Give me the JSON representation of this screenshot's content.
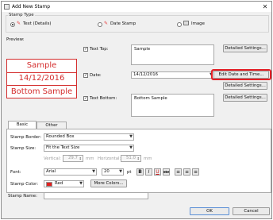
{
  "window": {
    "title": "Add New Stamp",
    "close_glyph": "✕"
  },
  "stamp_type": {
    "label": "Stamp Type",
    "options": [
      {
        "label": "Text (Details)",
        "selected": true
      },
      {
        "label": "Date Stamp",
        "selected": false
      },
      {
        "label": "Image",
        "selected": false
      }
    ]
  },
  "preview": {
    "label": "Preview:",
    "lines": [
      "Sample",
      "14/12/2016",
      "Bottom Sample"
    ],
    "color": "#d42d2d"
  },
  "text_top": {
    "label": "Text Top:",
    "checked": true,
    "value": "Sample",
    "button": "Detailed Settings..."
  },
  "date": {
    "label": "Date:",
    "checked": true,
    "value": "14/12/2016",
    "edit_button": "Edit Date and Time...",
    "button": "Detailed Settings..."
  },
  "text_bottom": {
    "label": "Text Bottom:",
    "checked": true,
    "value": "Bottom Sample",
    "button": "Detailed Settings..."
  },
  "tabs": [
    {
      "label": "Basic Settings",
      "active": true
    },
    {
      "label": "Other Settings",
      "active": false
    }
  ],
  "basic": {
    "border_label": "Stamp Border:",
    "border_value": "Rounded Box",
    "size_label": "Stamp Size:",
    "size_value": "Fit the Text Size",
    "vertical_label": "Vertical:",
    "vertical_value": "29.7",
    "horizontal_label": "Horizontal:",
    "horizontal_value": "51.0",
    "unit": "mm",
    "font_label": "Font:",
    "font_value": "Arial",
    "font_size": "20",
    "font_unit": "pt",
    "style_buttons": [
      "B",
      "I",
      "U",
      "abc"
    ],
    "align_buttons": [
      "≡",
      "≡",
      "≡"
    ],
    "color_label": "Stamp Color:",
    "color_value": "Red",
    "color_hex": "#e0201f",
    "more_colors": "More Colors..."
  },
  "stamp_name": {
    "label": "Stamp Name:",
    "value": ""
  },
  "footer": {
    "ok": "OK",
    "cancel": "Cancel"
  },
  "accent": "#e31f26"
}
